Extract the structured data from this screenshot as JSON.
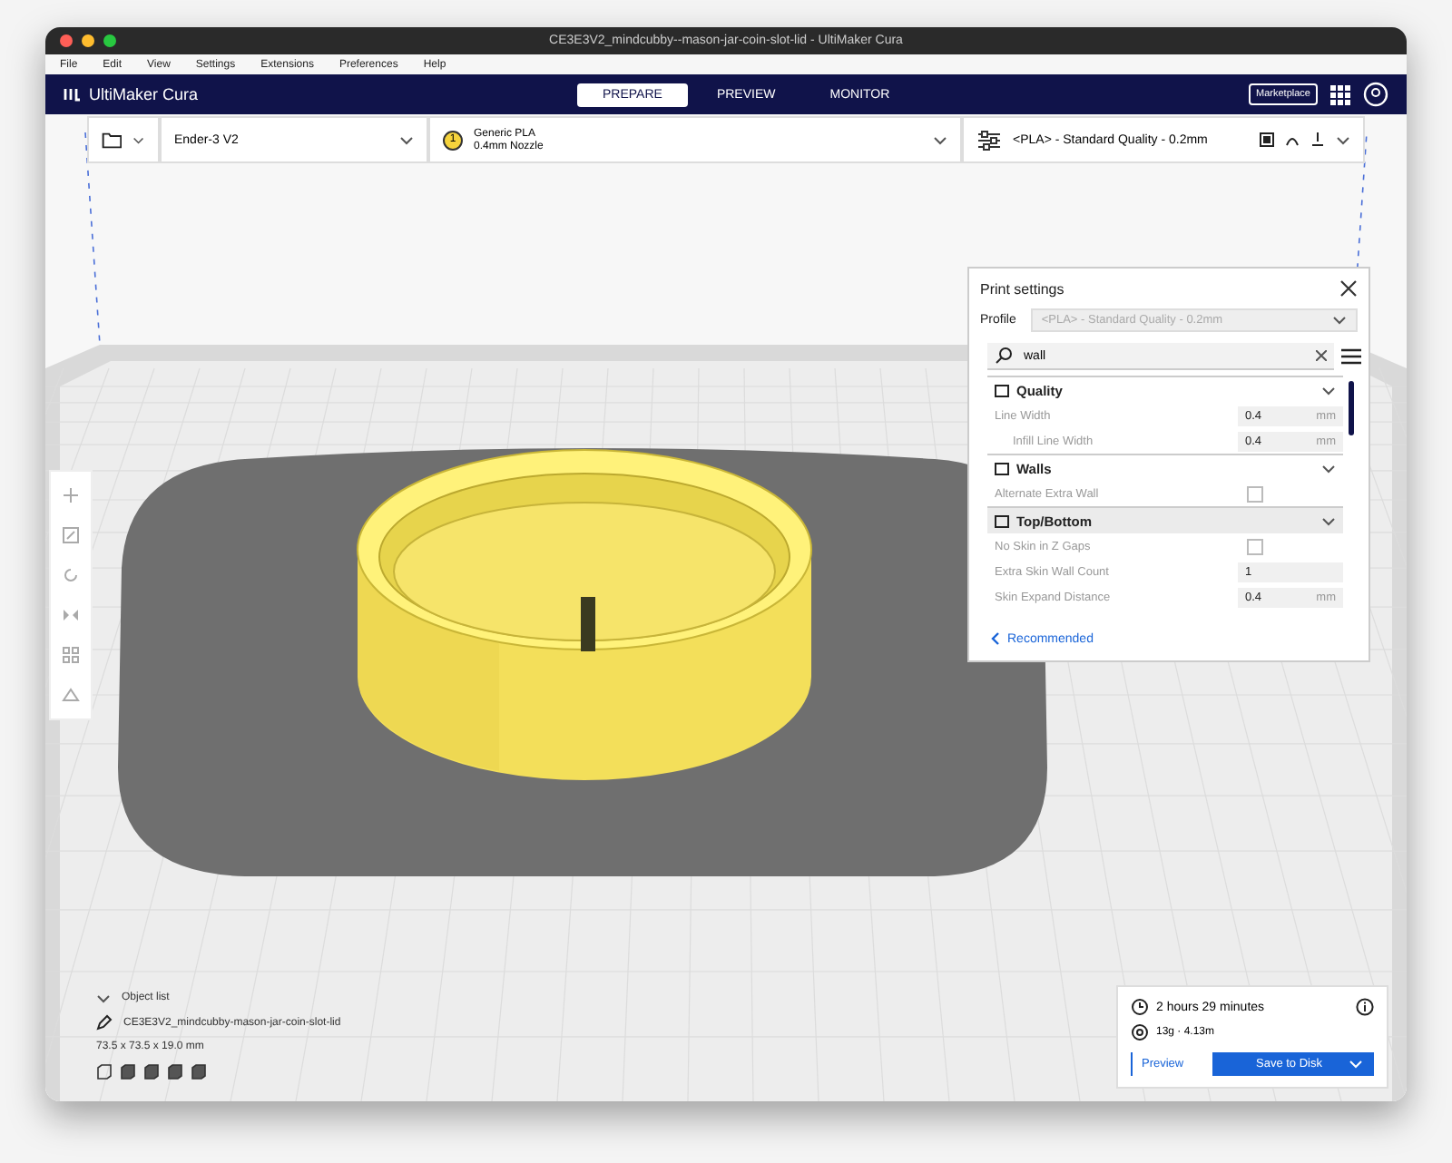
{
  "window": {
    "title": "CE3E3V2_mindcubby--mason-jar-coin-slot-lid - UltiMaker Cura"
  },
  "menu": [
    "File",
    "Edit",
    "View",
    "Settings",
    "Extensions",
    "Preferences",
    "Help"
  ],
  "header": {
    "logo": "UltiMaker Cura",
    "tabs": [
      {
        "label": "PREPARE",
        "selected": true
      },
      {
        "label": "PREVIEW",
        "selected": false
      },
      {
        "label": "MONITOR",
        "selected": false
      }
    ],
    "marketplace": "Marketplace"
  },
  "toolbar": {
    "printer": "Ender-3 V2",
    "extruder": "1",
    "material": "Generic PLA",
    "nozzle": "0.4mm Nozzle",
    "profile": "<PLA> - Standard Quality - 0.2mm"
  },
  "print_settings": {
    "title": "Print settings",
    "profile_label": "Profile",
    "profile_value": "<PLA> - Standard Quality - 0.2mm",
    "search": "wall",
    "rows": [
      {
        "kind": "section",
        "label": "Quality",
        "expanded": true,
        "selected": false
      },
      {
        "kind": "number",
        "label": "Line Width",
        "value": "0.4",
        "unit": "mm",
        "children": [
          {
            "kind": "number",
            "label": "Infill Line Width",
            "value": "0.4",
            "unit": "mm"
          }
        ]
      },
      {
        "kind": "section",
        "label": "Walls",
        "expanded": true,
        "selected": false
      },
      {
        "kind": "checkbox",
        "label": "Alternate Extra Wall",
        "checked": false
      },
      {
        "kind": "section",
        "label": "Top/Bottom",
        "expanded": true,
        "selected": true
      },
      {
        "kind": "checkbox",
        "label": "No Skin in Z Gaps",
        "checked": false
      },
      {
        "kind": "number",
        "label": "Extra Skin Wall Count",
        "value": "1",
        "unit": ""
      },
      {
        "kind": "number",
        "label": "Skin Expand Distance",
        "value": "0.4",
        "unit": "mm"
      }
    ],
    "footer": "Recommended"
  },
  "object_info": {
    "list_label": "Object list",
    "file": "CE3E3V2_mindcubby-mason-jar-coin-slot-lid",
    "dimensions": "73.5 x 73.5 x 19.0 mm"
  },
  "estimate": {
    "time": "2 hours 29 minutes",
    "material": "13g · 4.13m",
    "preview": "Preview",
    "save": "Save to Disk"
  }
}
